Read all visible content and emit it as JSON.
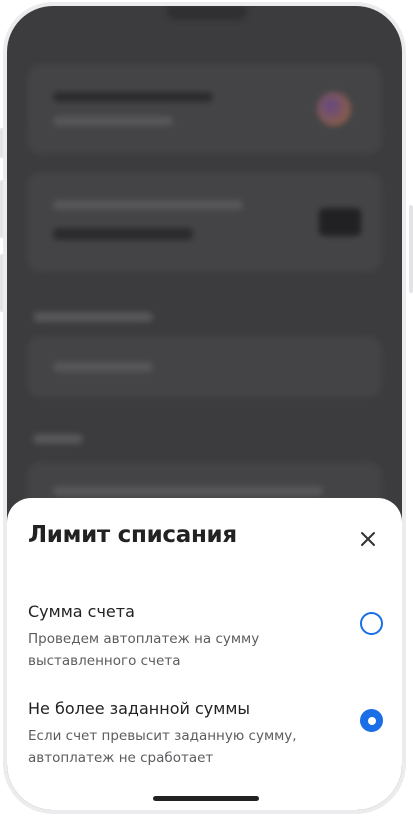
{
  "sheet": {
    "title": "Лимит списания",
    "options": [
      {
        "title": "Сумма счета",
        "description": "Проведем автоплатеж на сумму выставленного счета",
        "selected": false
      },
      {
        "title": "Не более заданной суммы",
        "description": "Если счет превысит заданную сумму, автоплатеж не сработает",
        "selected": true
      }
    ]
  },
  "icons": {
    "close": "close-icon",
    "radio_unselected": "radio-unselected-icon",
    "radio_selected": "radio-selected-icon"
  },
  "colors": {
    "accent": "#1a6fe6",
    "overlay": "#3c3c3e",
    "text_primary": "#222222",
    "text_secondary": "#5c5c60"
  }
}
